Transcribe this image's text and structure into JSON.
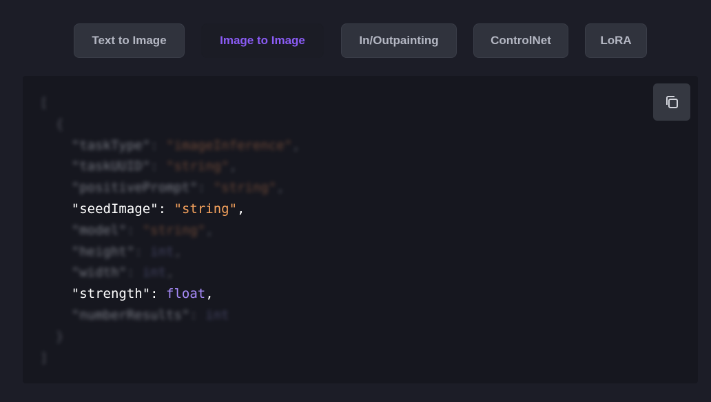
{
  "tabs": [
    {
      "label": "Text to Image",
      "active": false
    },
    {
      "label": "Image to Image",
      "active": true
    },
    {
      "label": "In/Outpainting",
      "active": false
    },
    {
      "label": "ControlNet",
      "active": false
    },
    {
      "label": "LoRA",
      "active": false
    }
  ],
  "code": {
    "open_bracket": "[",
    "open_brace": "{",
    "lines": [
      {
        "key": "\"taskType\"",
        "value": "\"imageInference\"",
        "value_kind": "string",
        "sep": ": ",
        "end": ",",
        "blurred": true
      },
      {
        "key": "\"taskUUID\"",
        "value": "\"string\"",
        "value_kind": "string",
        "sep": ": ",
        "end": ",",
        "blurred": true
      },
      {
        "key": "\"positivePrompt\"",
        "value": "\"string\"",
        "value_kind": "string",
        "sep": ": ",
        "end": ",",
        "blurred": true
      },
      {
        "key": "\"seedImage\"",
        "value": "\"string\"",
        "value_kind": "string",
        "sep": ": ",
        "end": ",",
        "blurred": false
      },
      {
        "key": "\"model\"",
        "value": "\"string\"",
        "value_kind": "string",
        "sep": ": ",
        "end": ",",
        "blurred": true
      },
      {
        "key": "\"height\"",
        "value": "int",
        "value_kind": "type",
        "sep": ": ",
        "end": ",",
        "blurred": true
      },
      {
        "key": "\"width\"",
        "value": "int",
        "value_kind": "type",
        "sep": ": ",
        "end": ",",
        "blurred": true
      },
      {
        "key": "\"strength\"",
        "value": "float",
        "value_kind": "type",
        "sep": ": ",
        "end": ",",
        "blurred": false
      },
      {
        "key": "\"numberResults\"",
        "value": "int",
        "value_kind": "type",
        "sep": ": ",
        "end": "",
        "blurred": true
      }
    ],
    "close_brace": "}",
    "close_bracket": "]"
  },
  "copy_button": {
    "icon": "copy-icon"
  },
  "colors": {
    "background": "#1c1d27",
    "panel": "#16171f",
    "tab_bg": "#30333d",
    "tab_active_text": "#8b5cf6",
    "string": "#f5a25d",
    "type": "#a78bfa"
  }
}
